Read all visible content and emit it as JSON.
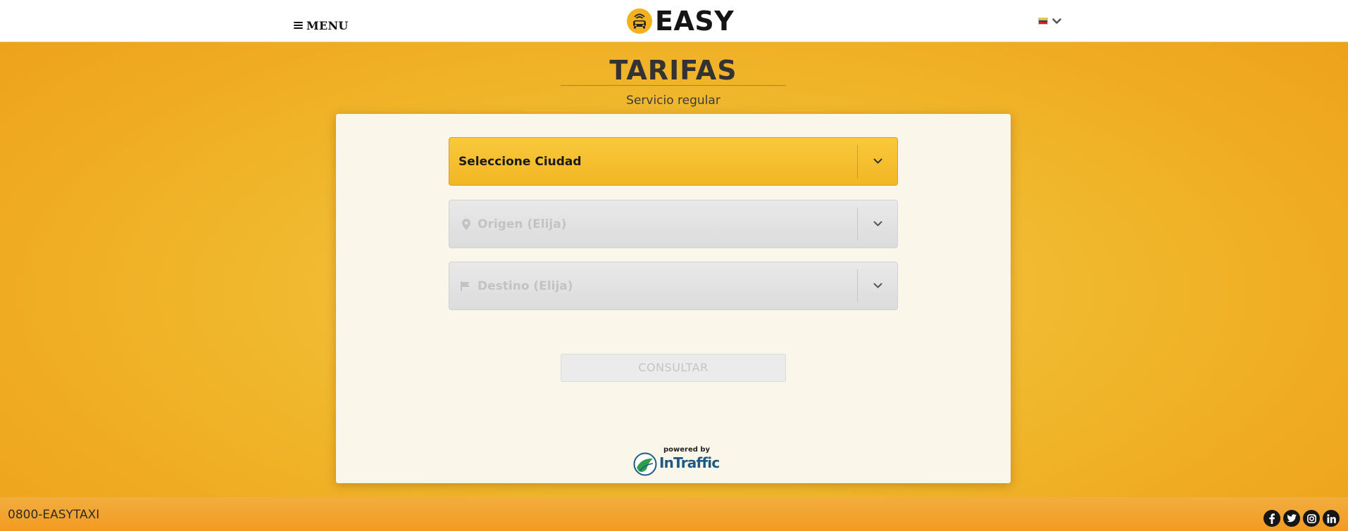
{
  "header": {
    "menu_label": "MENU",
    "logo_text": "EASY",
    "language_flag_colors": [
      "#f5c400",
      "#1b3fa6",
      "#d0202a"
    ]
  },
  "page": {
    "title": "TARIFAS",
    "subtitle": "Servicio regular"
  },
  "form": {
    "city_select": {
      "label": "Seleccione Ciudad"
    },
    "origin_select": {
      "label": "Origen (Elija)"
    },
    "destination_select": {
      "label": "Destino (Elija)"
    },
    "consult_button": {
      "label": "CONSULTAR"
    }
  },
  "powered": {
    "caption": "powered by",
    "brand": "InTraffic"
  },
  "footer": {
    "phone": "0800-EASYTAXI",
    "social": [
      "facebook",
      "twitter",
      "instagram",
      "linkedin"
    ]
  },
  "colors": {
    "accent": "#f3b623",
    "background": "#f0b72c",
    "card": "#faf6ea",
    "footer": "#f39a21"
  }
}
